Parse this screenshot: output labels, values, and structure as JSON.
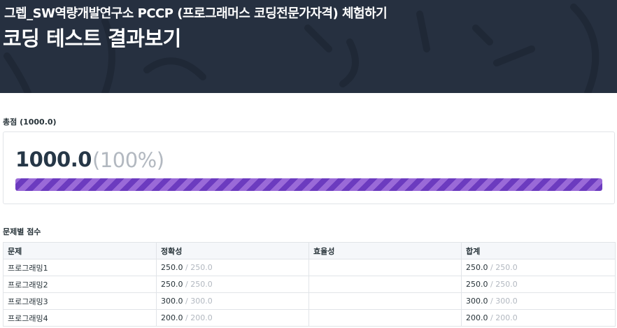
{
  "header": {
    "subtitle": "그렙_SW역량개발연구소 PCCP (프로그래머스 코딩전문가자격) 체험하기",
    "title": "코딩 테스트 결과보기"
  },
  "total": {
    "label": "총점 (1000.0)",
    "score": "1000.0",
    "percent_text": "(100%)",
    "progress_fraction": 1.0
  },
  "problems": {
    "label": "문제별 점수",
    "columns": [
      "문제",
      "정확성",
      "효율성",
      "합계"
    ],
    "rows": [
      {
        "name": "프로그래밍1",
        "accuracy": "250.0",
        "accuracy_max": "/ 250.0",
        "efficiency": "",
        "sum": "250.0",
        "sum_max": "/ 250.0"
      },
      {
        "name": "프로그래밍2",
        "accuracy": "250.0",
        "accuracy_max": "/ 250.0",
        "efficiency": "",
        "sum": "250.0",
        "sum_max": "/ 250.0"
      },
      {
        "name": "프로그래밍3",
        "accuracy": "300.0",
        "accuracy_max": "/ 300.0",
        "efficiency": "",
        "sum": "300.0",
        "sum_max": "/ 300.0"
      },
      {
        "name": "프로그래밍4",
        "accuracy": "200.0",
        "accuracy_max": "/ 200.0",
        "efficiency": "",
        "sum": "200.0",
        "sum_max": "/ 200.0"
      }
    ]
  },
  "colors": {
    "header_bg": "#263040",
    "progress_primary": "#6c3bbf",
    "progress_secondary": "#9a6ad8",
    "muted_text": "#b2b8c0"
  }
}
